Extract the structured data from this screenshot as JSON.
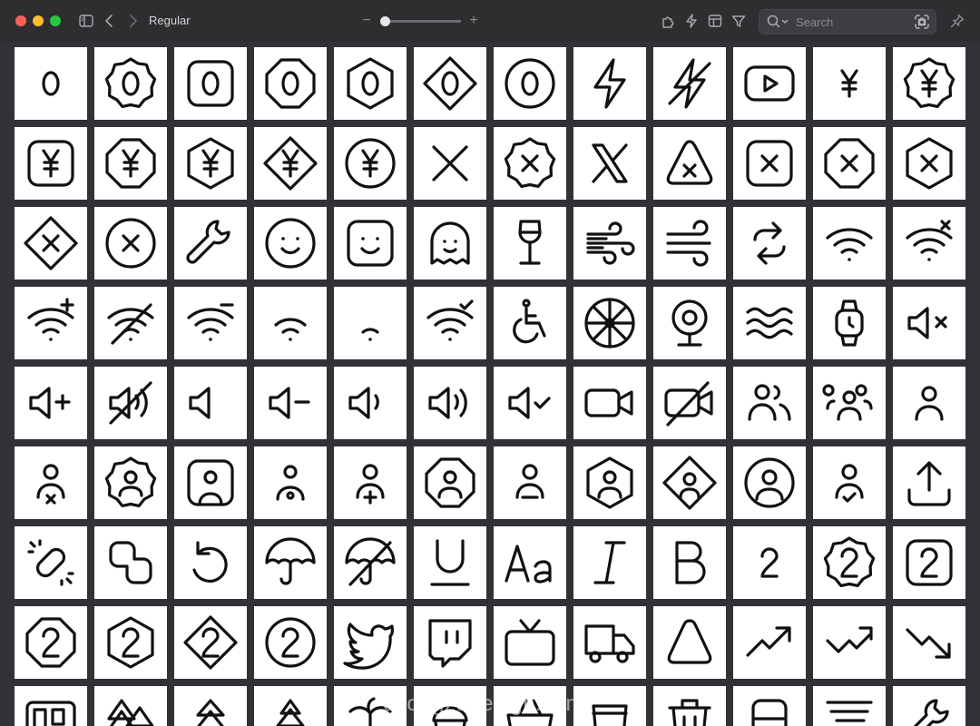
{
  "toolbar": {
    "view_label": "Regular",
    "zoom_level": 0.05,
    "zoom_out_label": "−",
    "zoom_in_label": "+"
  },
  "search": {
    "placeholder": "Search",
    "value": ""
  },
  "watermark": "chongzudesign.com",
  "icons": [
    [
      "number-0",
      "number-0-badge",
      "number-0-square",
      "number-0-octagon",
      "number-0-hexagon",
      "number-0-diamond",
      "number-0-circle",
      "flash",
      "flash-off",
      "youtube",
      "yen",
      "yen-badge"
    ],
    [
      "yen-square",
      "yen-octagon",
      "yen-hexagon",
      "yen-diamond",
      "yen-circle",
      "x",
      "x-badge",
      "x-logo",
      "x-triangle",
      "x-square",
      "x-octagon",
      "x-hexagon"
    ],
    [
      "x-diamond",
      "x-circle",
      "wrench",
      "smile-circle",
      "smile-square",
      "ghost",
      "wine-glass",
      "wind",
      "wind-lines",
      "arrows-swap",
      "wifi",
      "wifi-x"
    ],
    [
      "wifi-plus",
      "wifi-off",
      "wifi-minus",
      "wifi-low",
      "wifi-min",
      "wifi-check",
      "wheelchair",
      "wheel",
      "webcam",
      "waves",
      "watch",
      "volume-x"
    ],
    [
      "volume-plus",
      "volume-off",
      "volume-mute",
      "volume-minus",
      "volume-low",
      "volume-high",
      "volume-check",
      "video",
      "video-off",
      "users",
      "users-group",
      "user"
    ],
    [
      "user-x",
      "user-badge",
      "user-square",
      "user-circle-small",
      "user-plus",
      "user-octagon",
      "user-minus",
      "user-hexagon",
      "user-diamond",
      "user-circle",
      "user-check",
      "upload"
    ],
    [
      "unlink",
      "union",
      "undo",
      "umbrella",
      "umbrella-off",
      "underline",
      "typography",
      "italic",
      "bold",
      "number-2",
      "number-2-badge",
      "number-2-square"
    ],
    [
      "number-2-octagon",
      "number-2-hexagon",
      "number-2-diamond",
      "number-2-circle",
      "twitter",
      "twitch",
      "tv",
      "truck",
      "triangle-rounded",
      "trending-up",
      "trending-down-up",
      "trending-down"
    ],
    [
      "trello",
      "trees",
      "tree",
      "tree-pine",
      "palm-tree",
      "cupcake",
      "basket",
      "cup",
      "trash",
      "train",
      "tornado",
      "tool"
    ]
  ],
  "colors": {
    "background": "#323236",
    "titlebar": "#2e2e31",
    "cell": "#ffffff",
    "stroke": "#111111",
    "close": "#ff5f57",
    "minimize": "#febc2e",
    "zoom": "#28c840"
  }
}
